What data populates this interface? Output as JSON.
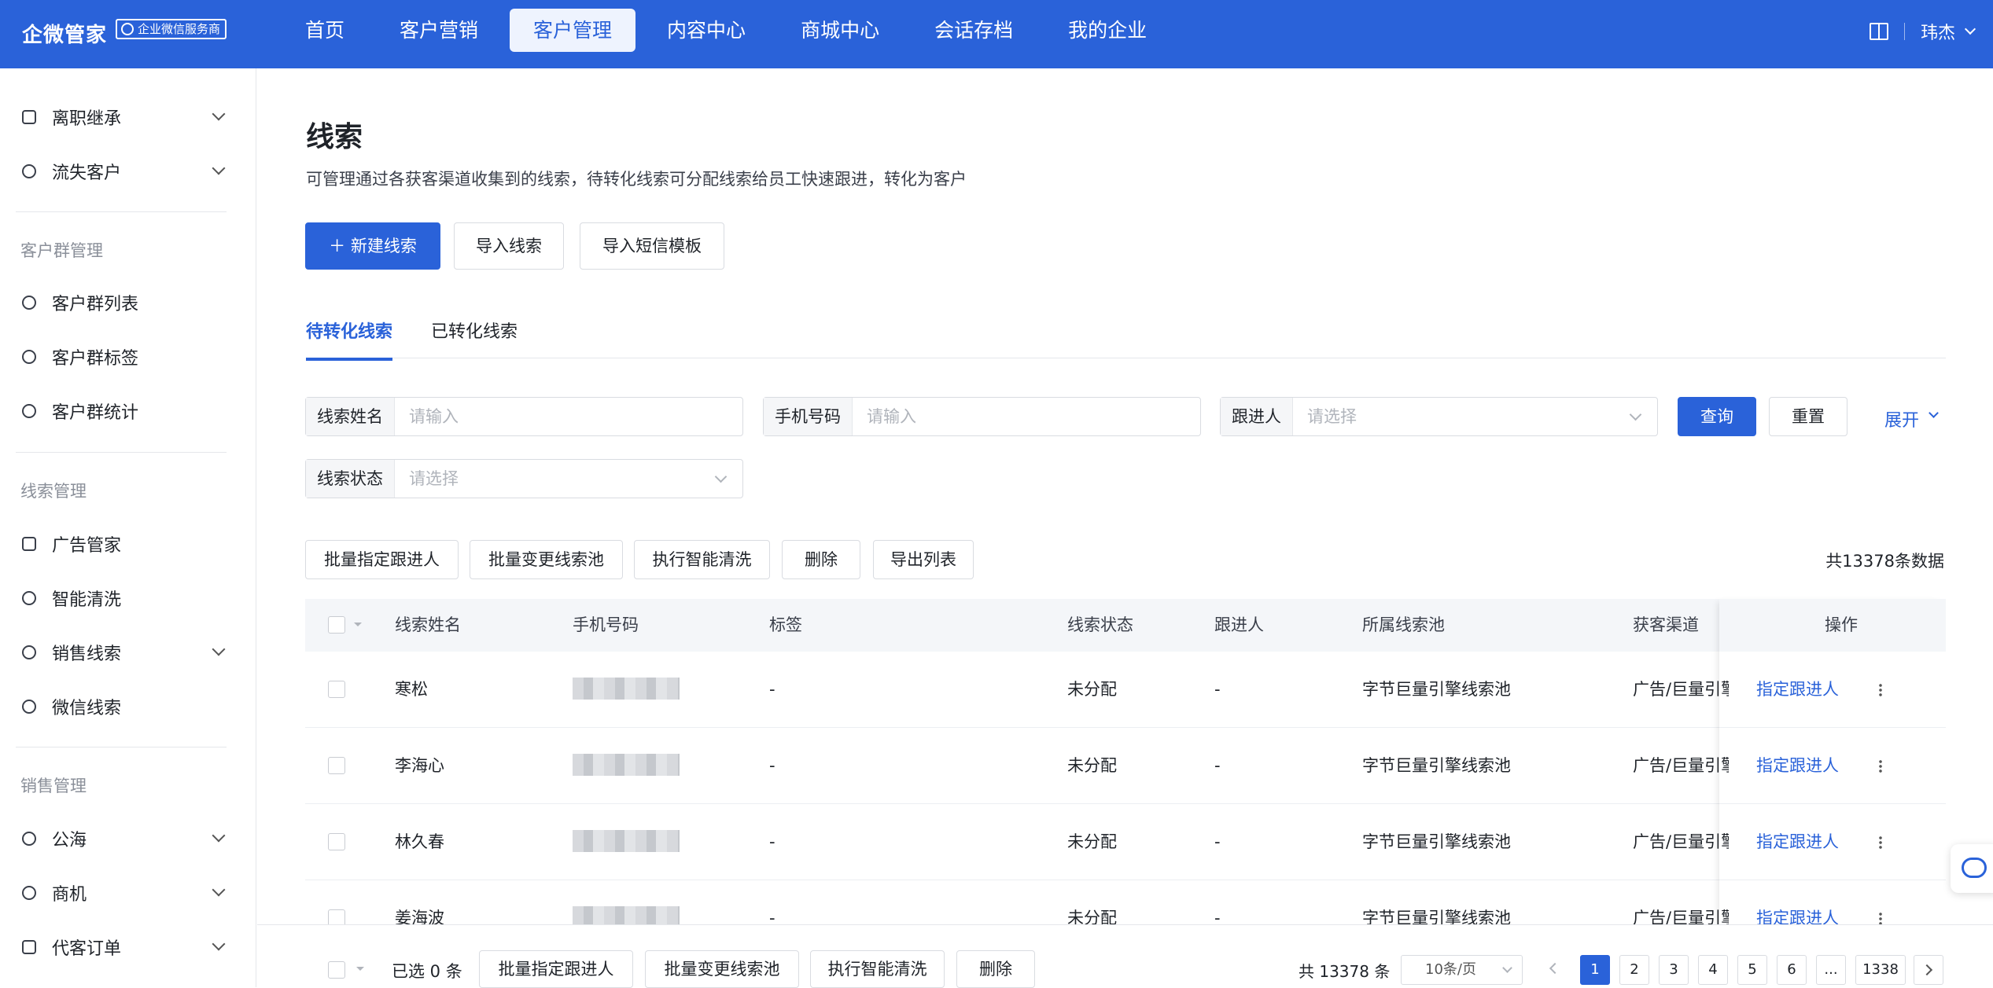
{
  "brand": {
    "name": "企微管家",
    "badge": "企业微信服务商"
  },
  "nav": [
    "首页",
    "客户营销",
    "客户管理",
    "内容中心",
    "商城中心",
    "会话存档",
    "我的企业"
  ],
  "user": {
    "name": "玮杰"
  },
  "sidebar": {
    "item_exit": "离职继承",
    "item_lost": "流失客户",
    "group_chat": "客户群管理",
    "item_group_list": "客户群列表",
    "item_group_tag": "客户群标签",
    "item_group_stat": "客户群统计",
    "group_lead": "线索管理",
    "item_ad": "广告管家",
    "item_clean": "智能清洗",
    "item_sales_lead": "销售线索",
    "item_wx_lead": "微信线索",
    "group_sales": "销售管理",
    "item_sea": "公海",
    "item_opp": "商机",
    "item_order": "代客订单"
  },
  "page": {
    "title": "线索",
    "desc": "可管理通过各获客渠道收集到的线索，待转化线索可分配线索给员工快速跟进，转化为客户"
  },
  "actions": {
    "new": "新建线索",
    "import": "导入线索",
    "sms": "导入短信模板"
  },
  "tabs": {
    "pending": "待转化线索",
    "converted": "已转化线索"
  },
  "filters": {
    "name_label": "线索姓名",
    "name_ph": "请输入",
    "phone_label": "手机号码",
    "phone_ph": "请输入",
    "follower_label": "跟进人",
    "follower_ph": "请选择",
    "status_label": "线索状态",
    "status_ph": "请选择",
    "query": "查询",
    "reset": "重置",
    "expand": "展开"
  },
  "batch": {
    "assign": "批量指定跟进人",
    "change_pool": "批量变更线索池",
    "clean": "执行智能清洗",
    "delete": "删除",
    "export": "导出列表",
    "total": "共13378条数据"
  },
  "table": {
    "headers": {
      "name": "线索姓名",
      "phone": "手机号码",
      "tag": "标签",
      "status": "线索状态",
      "follower": "跟进人",
      "pool": "所属线索池",
      "channel": "获客渠道",
      "op": "操作"
    },
    "rows": [
      {
        "name": "寒松",
        "tag": "-",
        "status": "未分配",
        "follower": "-",
        "pool": "字节巨量引擎线索池",
        "channel": "广告/巨量引擎",
        "op": "指定跟进人"
      },
      {
        "name": "李海心",
        "tag": "-",
        "status": "未分配",
        "follower": "-",
        "pool": "字节巨量引擎线索池",
        "channel": "广告/巨量引擎",
        "op": "指定跟进人"
      },
      {
        "name": "林久春",
        "tag": "-",
        "status": "未分配",
        "follower": "-",
        "pool": "字节巨量引擎线索池",
        "channel": "广告/巨量引擎",
        "op": "指定跟进人"
      },
      {
        "name": "姜海波",
        "tag": "-",
        "status": "未分配",
        "follower": "-",
        "pool": "字节巨量引擎线索池",
        "channel": "广告/巨量引擎",
        "op": "指定跟进人"
      }
    ]
  },
  "footer": {
    "selected": "已选 0 条",
    "assign": "批量指定跟进人",
    "change_pool": "批量变更线索池",
    "clean": "执行智能清洗",
    "delete": "删除",
    "total": "共 13378 条",
    "page_size": "10条/页",
    "pages": [
      "1",
      "2",
      "3",
      "4",
      "5",
      "6",
      "...",
      "1338"
    ]
  }
}
